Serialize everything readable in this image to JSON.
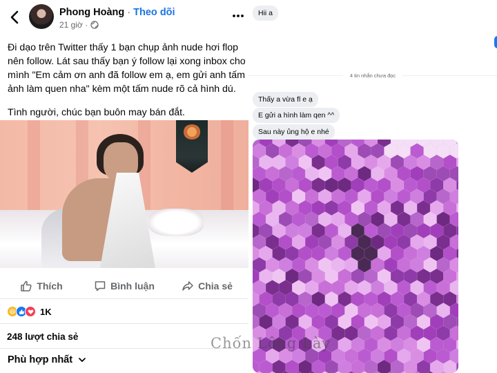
{
  "post": {
    "author": "Phong Hoàng",
    "separator": "·",
    "follow": "Theo dõi",
    "time": "21 giờ ·",
    "paragraph_1": "Đi dạo trên Twitter thấy 1 bạn chụp ảnh nude hơi flop nên follow. Lát sau thấy bạn ý follow lại xong inbox cho mình \"Em cảm ơn anh đã follow em ạ, em gửi anh tấm ảnh làm quen nha\" kèm một tấm nude rõ cả hình dú.",
    "paragraph_2": "Tình người, chúc bạn buôn may bán đắt.",
    "actions": {
      "like": "Thích",
      "comment": "Bình luận",
      "share": "Chia sẻ"
    },
    "reactions": {
      "count": "1K",
      "types": [
        "haha-icon",
        "like-icon",
        "love-icon"
      ]
    },
    "shares": "248 lượt chia sẻ",
    "sort": "Phù hợp nhất",
    "colors": {
      "follow": "#1b74e4",
      "secondary": "#65676b"
    }
  },
  "chat": {
    "first_message": "Hii a",
    "unread_divider": "4 tin nhắn chưa đọc",
    "messages": [
      "Thấy a vừa fl e ạ",
      "E gửi a hình làm qen ^^",
      "Sau này ủng hộ e nhé"
    ],
    "bubble_color": "#eceef1",
    "image_tint": "#b04cc7"
  },
  "watermark": "Chốn Lông Lày"
}
